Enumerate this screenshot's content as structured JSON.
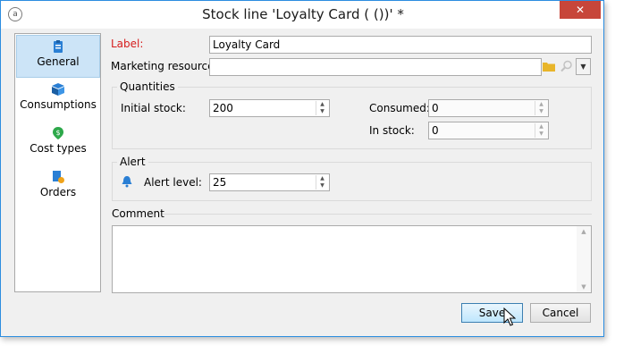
{
  "window": {
    "title": "Stock line 'Loyalty Card ( ())' *",
    "close_label": "✕"
  },
  "sidebar": {
    "items": [
      {
        "label": "General",
        "icon": "clipboard-icon",
        "selected": true
      },
      {
        "label": "Consumptions",
        "icon": "boxes-icon"
      },
      {
        "label": "Cost types",
        "icon": "money-icon"
      },
      {
        "label": "Orders",
        "icon": "order-icon"
      }
    ]
  },
  "general": {
    "label_caption": "Label:",
    "label_value": "Loyalty Card",
    "marketing_resource_caption": "Marketing resource:",
    "marketing_resource_value": ""
  },
  "quantities": {
    "group_label": "Quantities",
    "initial_stock_caption": "Initial stock:",
    "initial_stock_value": "200",
    "consumed_caption": "Consumed:",
    "consumed_value": "0",
    "in_stock_caption": "In stock:",
    "in_stock_value": "0"
  },
  "alert": {
    "group_label": "Alert",
    "alert_level_caption": "Alert level:",
    "alert_level_value": "25"
  },
  "comment": {
    "label": "Comment",
    "value": ""
  },
  "buttons": {
    "save": "Save",
    "cancel": "Cancel"
  },
  "colors": {
    "accent": "#2c8de0",
    "close": "#c7463a",
    "required": "#d61d1d",
    "selected_bg": "#cce4f7"
  }
}
